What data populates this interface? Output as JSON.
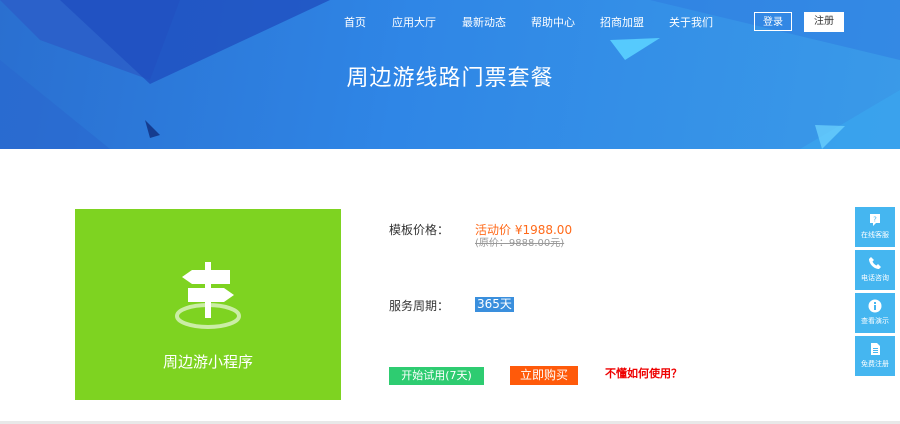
{
  "nav": {
    "items": [
      "首页",
      "应用大厅",
      "最新动态",
      "帮助中心",
      "招商加盟",
      "关于我们"
    ],
    "login": "登录",
    "register": "注册"
  },
  "hero": {
    "title": "周边游线路门票套餐"
  },
  "product": {
    "name": "周边游小程序",
    "price_label": "模板价格：",
    "price_now": "活动价 ¥1988.00",
    "price_old": "(原价：9888.00元)",
    "period_label": "服务周期：",
    "period_value": "365天",
    "trial_button": "开始试用(7天)",
    "buy_button": "立即购买",
    "howto_link": "不懂如何使用？"
  },
  "sidebar": {
    "items": [
      {
        "label": "在线客服",
        "icon": "question-icon"
      },
      {
        "label": "电话咨询",
        "icon": "phone-icon"
      },
      {
        "label": "查看演示",
        "icon": "info-icon"
      },
      {
        "label": "免费注册",
        "icon": "document-icon"
      }
    ]
  },
  "colors": {
    "card": "#7ed321",
    "accent": "#45b6f0",
    "buy": "#ff5a0a",
    "trial": "#2ecc71"
  }
}
